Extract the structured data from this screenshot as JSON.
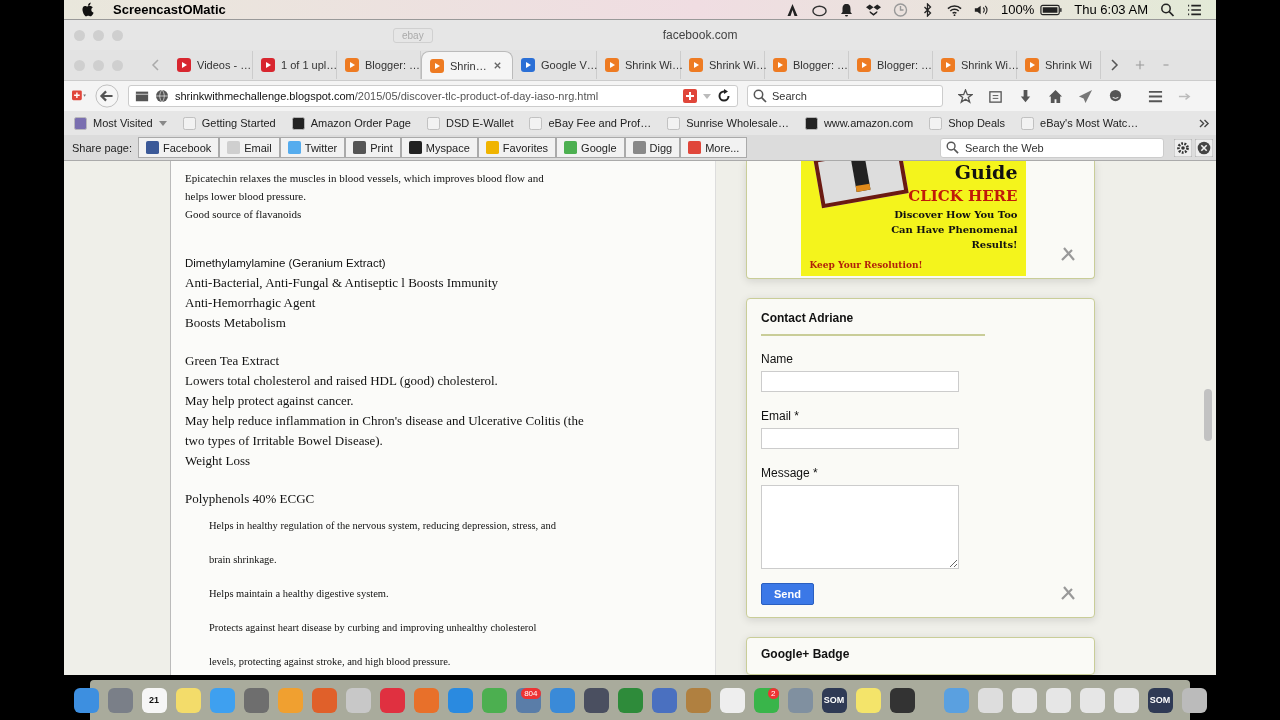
{
  "menubar": {
    "app": "ScreencastOMatic",
    "battery": "100%",
    "clock": "Thu 6:03 AM"
  },
  "back_window": {
    "url": "facebook.com",
    "button": "ebay"
  },
  "tabs": [
    {
      "label": "Videos - …",
      "kind": "youtube",
      "selected": false
    },
    {
      "label": "1 of 1 upl…",
      "kind": "youtube",
      "selected": false
    },
    {
      "label": "Blogger: …",
      "kind": "blogger",
      "selected": false
    },
    {
      "label": "Shrin…",
      "kind": "blogger",
      "selected": true
    },
    {
      "label": "Google V…",
      "kind": "voice",
      "selected": false
    },
    {
      "label": "Shrink Wi…",
      "kind": "blogger",
      "selected": false
    },
    {
      "label": "Shrink Wi…",
      "kind": "blogger",
      "selected": false
    },
    {
      "label": "Blogger: …",
      "kind": "blogger",
      "selected": false
    },
    {
      "label": "Blogger: …",
      "kind": "blogger",
      "selected": false
    },
    {
      "label": "Shrink Wi…",
      "kind": "blogger",
      "selected": false
    },
    {
      "label": "Shrink Wi",
      "kind": "blogger",
      "selected": false
    }
  ],
  "navbar": {
    "url_host": "shrinkwithmechallenge.blogspot.com",
    "url_path": "/2015/05/discover-tlc-product-of-day-iaso-nrg.html",
    "search_placeholder": "Search"
  },
  "bookmarks": [
    {
      "label": "Most Visited",
      "kind": "folder"
    },
    {
      "label": "Getting Started",
      "kind": "page"
    },
    {
      "label": "Amazon Order Page",
      "kind": "amazon"
    },
    {
      "label": "DSD E-Wallet",
      "kind": "page"
    },
    {
      "label": "eBay Fee and Prof…",
      "kind": "page"
    },
    {
      "label": "Sunrise Wholesale…",
      "kind": "page"
    },
    {
      "label": "www.amazon.com",
      "kind": "amazon"
    },
    {
      "label": "Shop Deals",
      "kind": "page"
    },
    {
      "label": "eBay's Most Watc…",
      "kind": "page"
    }
  ],
  "sharebar": {
    "label": "Share page:",
    "buttons": [
      {
        "label": "Facebook",
        "kind": "facebook"
      },
      {
        "label": "Email",
        "kind": "email"
      },
      {
        "label": "Twitter",
        "kind": "twitter"
      },
      {
        "label": "Print",
        "kind": "print"
      },
      {
        "label": "Myspace",
        "kind": "myspace"
      },
      {
        "label": "Favorites",
        "kind": "favorites"
      },
      {
        "label": "Google",
        "kind": "google"
      },
      {
        "label": "Digg",
        "kind": "digg"
      },
      {
        "label": "More...",
        "kind": "more"
      }
    ],
    "search_placeholder": "Search the Web"
  },
  "article": {
    "sections": [
      {
        "lines": [
          {
            "text": "Epicatechin relaxes the muscles in blood vessels, which improves blood flow and",
            "kind": "small"
          },
          {
            "text": "helps lower blood pressure.",
            "kind": "small"
          },
          {
            "text": "Good source of flavanoids",
            "kind": "small"
          }
        ]
      },
      {
        "lines": [
          {
            "text": "Dimethylamylamine (Geranium Extract)",
            "kind": "sans"
          },
          {
            "text": "Anti-Bacterial, Anti-Fungal & Antiseptic l Boosts Immunity",
            "kind": "large"
          },
          {
            "text": "Anti-Hemorrhagic Agent",
            "kind": "large"
          },
          {
            "text": "Boosts Metabolism",
            "kind": "large"
          }
        ]
      },
      {
        "lines": [
          {
            "text": "Green Tea Extract",
            "kind": "large"
          },
          {
            "text": "Lowers total cholesterol and raised HDL (good) cholesterol.",
            "kind": "large"
          },
          {
            "text": "May help protect against cancer.",
            "kind": "large"
          },
          {
            "text": "May help reduce inflammation in Chron's disease and Ulcerative Colitis (the",
            "kind": "large"
          },
          {
            "text": "two types of Irritable Bowel Disease).",
            "kind": "large"
          },
          {
            "text": "Weight Loss",
            "kind": "large"
          }
        ]
      },
      {
        "lines": [
          {
            "text": "Polyphenols 40% ECGC",
            "kind": "large"
          },
          {
            "text": "Helps in healthy regulation of the nervous system, reducing depression, stress, and",
            "kind": "indent"
          },
          {
            "text": "brain shrinkage.",
            "kind": "indent"
          },
          {
            "text": "Helps maintain a healthy digestive system.",
            "kind": "indent"
          },
          {
            "text": "Protects against heart disease by curbing and improving unhealthy cholesterol",
            "kind": "indent"
          },
          {
            "text": "levels, protecting against stroke, and high blood pressure.",
            "kind": "indent"
          }
        ]
      }
    ]
  },
  "sidebar": {
    "banner": {
      "title": "Guide",
      "cta": "CLICK HERE",
      "lines": [
        "Discover How You Too",
        "Can Have Phenomenal",
        "Results!"
      ],
      "slogan": "Keep Your Resolution!"
    },
    "contact": {
      "title": "Contact Adriane",
      "fields": [
        {
          "label": "Name",
          "kind": "input"
        },
        {
          "label": "Email *",
          "kind": "input"
        },
        {
          "label": "Message *",
          "kind": "textarea"
        }
      ],
      "button": "Send"
    },
    "badge_title": "Google+ Badge"
  },
  "dock": [
    {
      "color": "#3d8fe0"
    },
    {
      "color": "#7a7f88"
    },
    {
      "color": "#f6f6f6",
      "label": "21"
    },
    {
      "color": "#f3dc6a"
    },
    {
      "color": "#3ea0f0"
    },
    {
      "color": "#6e6e6e"
    },
    {
      "color": "#f0a030"
    },
    {
      "color": "#e0602a"
    },
    {
      "color": "#c8c8c8"
    },
    {
      "color": "#e03040"
    },
    {
      "color": "#e8702a"
    },
    {
      "color": "#2a8ae0"
    },
    {
      "color": "#4caf50"
    },
    {
      "color": "#5a7da8",
      "badge": "804"
    },
    {
      "color": "#3a8ad8"
    },
    {
      "color": "#4a4f60"
    },
    {
      "color": "#2e8b3a"
    },
    {
      "color": "#4a70c0"
    },
    {
      "color": "#b08040"
    },
    {
      "color": "#eeeeee"
    },
    {
      "color": "#39b54a",
      "badge": "2"
    },
    {
      "color": "#8090a0"
    },
    {
      "color": "#2f3a55",
      "label": "SOM"
    },
    {
      "color": "#f4e46a"
    },
    {
      "color": "#333333"
    },
    {
      "color": "#5aa0e0"
    },
    {
      "color": "#dddddd"
    },
    {
      "color": "#e6e6e6"
    },
    {
      "color": "#e6e6e6"
    },
    {
      "color": "#e6e6e6"
    },
    {
      "color": "#e6e6e6"
    },
    {
      "color": "#2f3a55",
      "label": "SOM"
    },
    {
      "color": "#bbbbbb"
    }
  ]
}
